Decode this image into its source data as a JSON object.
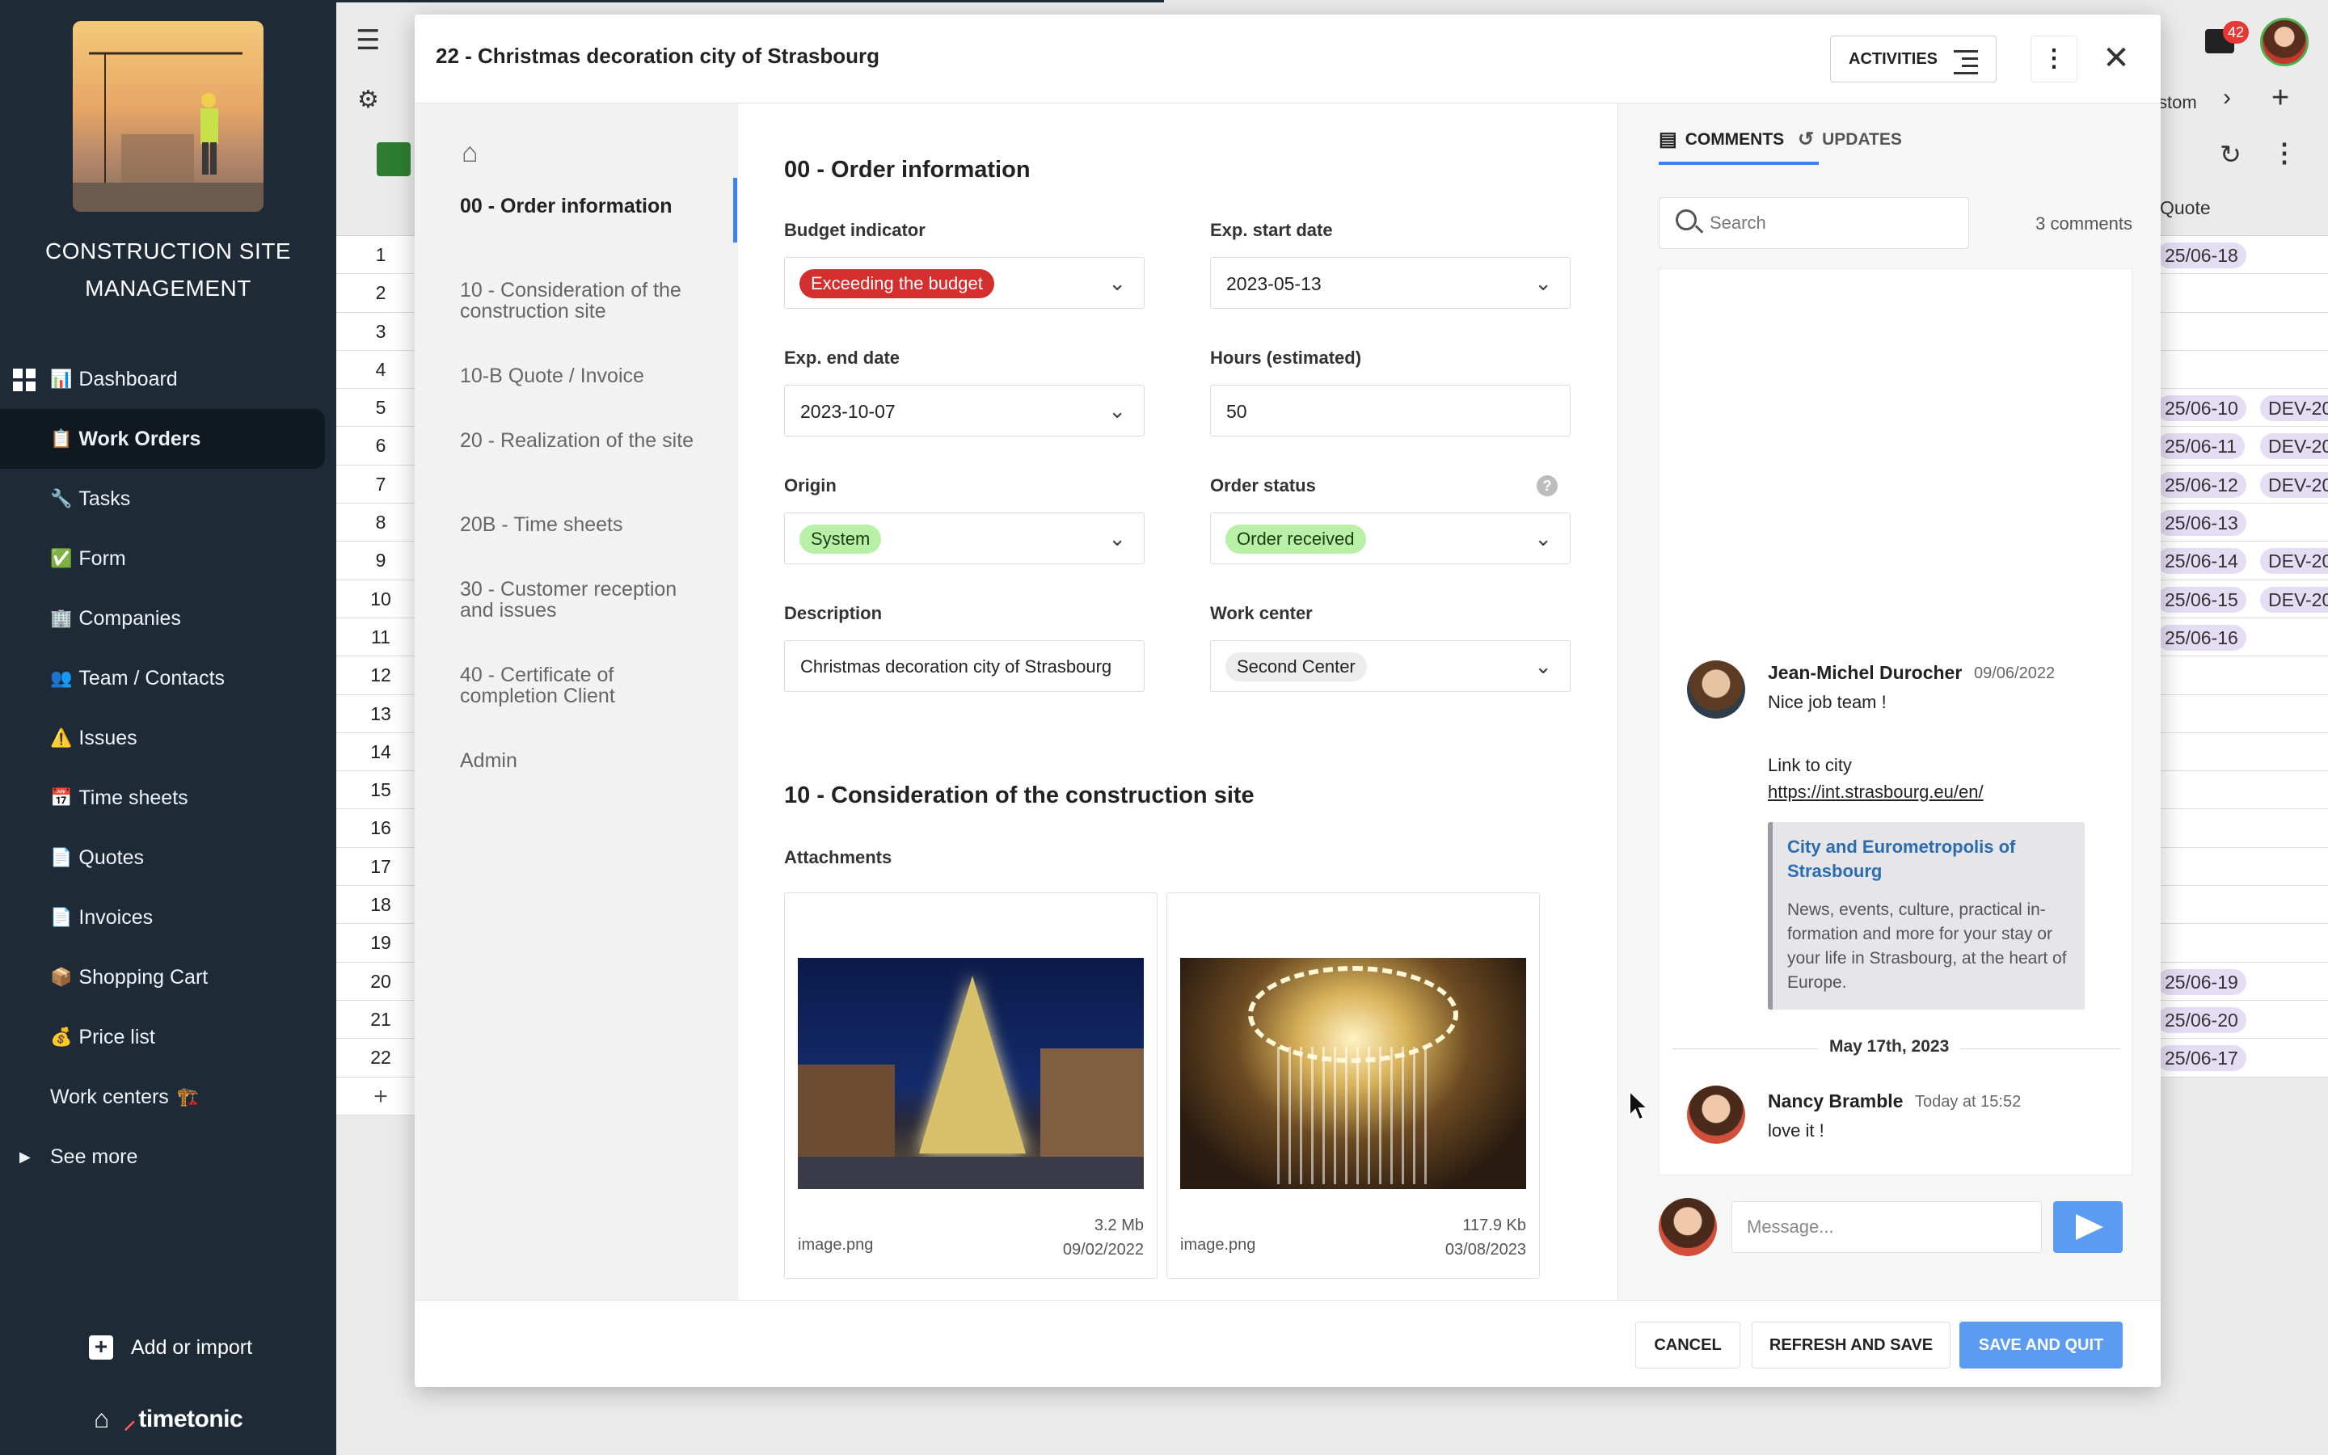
{
  "app": {
    "title": "CONSTRUCTION SITE MANAGEMENT",
    "brand_name": "timetonic",
    "add_import_label": "Add or import",
    "notification_count": "42"
  },
  "sidebar": {
    "items": [
      {
        "emoji": "📊",
        "label": "Dashboard"
      },
      {
        "emoji": "📋",
        "label": "Work Orders",
        "active": true
      },
      {
        "emoji": "🔧",
        "label": "Tasks"
      },
      {
        "emoji": "✅",
        "label": "Form"
      },
      {
        "emoji": "🏢",
        "label": "Companies"
      },
      {
        "emoji": "👥",
        "label": "Team / Contacts"
      },
      {
        "emoji": "⚠️",
        "label": "Issues"
      },
      {
        "emoji": "📅",
        "label": "Time sheets"
      },
      {
        "emoji": "📄",
        "label": "Quotes"
      },
      {
        "emoji": "📄",
        "label": "Invoices"
      },
      {
        "emoji": "📦",
        "label": "Shopping Cart"
      },
      {
        "emoji": "💰",
        "label": "Price list"
      },
      {
        "emoji": "🏗️",
        "label": "Work centers",
        "emoji_after": true
      },
      {
        "emoji": "",
        "label": "See more",
        "expandable": true
      }
    ]
  },
  "background_table": {
    "row_numbers": [
      "1",
      "2",
      "3",
      "4",
      "5",
      "6",
      "7",
      "8",
      "9",
      "10",
      "11",
      "12",
      "13",
      "14",
      "15",
      "16",
      "17",
      "18",
      "19",
      "20",
      "21",
      "22"
    ],
    "quote_header": "Quote",
    "breadcrumb_tail": "stom",
    "right_cells": [
      {
        "date": "25/06-18",
        "dev": ""
      },
      {
        "date": "",
        "dev": ""
      },
      {
        "date": "",
        "dev": ""
      },
      {
        "date": "",
        "dev": ""
      },
      {
        "date": "25/06-10",
        "dev": "DEV-20"
      },
      {
        "date": "25/06-11",
        "dev": "DEV-20"
      },
      {
        "date": "25/06-12",
        "dev": "DEV-20"
      },
      {
        "date": "25/06-13",
        "dev": ""
      },
      {
        "date": "25/06-14",
        "dev": "DEV-20"
      },
      {
        "date": "25/06-15",
        "dev": "DEV-20"
      },
      {
        "date": "25/06-16",
        "dev": ""
      },
      {
        "date": "",
        "dev": ""
      },
      {
        "date": "",
        "dev": ""
      },
      {
        "date": "",
        "dev": ""
      },
      {
        "date": "",
        "dev": ""
      },
      {
        "date": "",
        "dev": ""
      },
      {
        "date": "",
        "dev": ""
      },
      {
        "date": "",
        "dev": ""
      },
      {
        "date": "",
        "dev": ""
      },
      {
        "date": "25/06-19",
        "dev": ""
      },
      {
        "date": "25/06-20",
        "dev": ""
      },
      {
        "date": "25/06-17",
        "dev": ""
      }
    ]
  },
  "modal": {
    "title": "22 - Christmas decoration city of Strasbourg",
    "activities_label": "ACTIVITIES",
    "sections": [
      {
        "label": "00 - Order information",
        "active": true
      },
      {
        "label": "10 - Consideration of the construction site"
      },
      {
        "label": "10-B Quote / Invoice"
      },
      {
        "label": "20 - Realization of the site"
      },
      {
        "label": "20B - Time sheets"
      },
      {
        "label": "30 - Customer reception and issues"
      },
      {
        "label": "40 - Certificate of completion Client"
      },
      {
        "label": "Admin"
      }
    ],
    "form": {
      "section_title": "00 - Order information",
      "budget_indicator": {
        "label": "Budget indicator",
        "value": "Exceeding the budget",
        "color": "#d32f2f"
      },
      "exp_start_date": {
        "label": "Exp. start date",
        "value": "2023-05-13"
      },
      "exp_end_date": {
        "label": "Exp. end date",
        "value": "2023-10-07"
      },
      "hours_estimated": {
        "label": "Hours (estimated)",
        "value": "50"
      },
      "origin": {
        "label": "Origin",
        "value": "System",
        "color": "#b9f0a8"
      },
      "order_status": {
        "label": "Order status",
        "value": "Order received",
        "color": "#b9f0a8"
      },
      "description": {
        "label": "Description",
        "value": "Christmas decoration city of Strasbourg"
      },
      "work_center": {
        "label": "Work center",
        "value": "Second Center"
      },
      "section2_title": "10 - Consideration of the construction site",
      "attachments_label": "Attachments",
      "attachments": [
        {
          "name": "image.png",
          "size": "3.2 Mb",
          "date": "09/02/2022"
        },
        {
          "name": "image.png",
          "size": "117.9 Kb",
          "date": "03/08/2023"
        }
      ]
    },
    "comments_panel": {
      "tab_comments": "COMMENTS",
      "tab_updates": "UPDATES",
      "search_placeholder": "Search",
      "count": "3 comments",
      "comments": [
        {
          "author": "Jean-Michel Durocher",
          "time": "09/06/2022",
          "text": "Nice job team !"
        },
        {
          "author": "",
          "time": "",
          "text": "Link to city",
          "link": "https://int.strasbourg.eu/en/",
          "preview_title": "City and Eurometropolis of Strasbourg",
          "preview_desc": "News, events, culture, practical in-formation and more for your stay or your life in Strasbourg, at the heart of Europe."
        },
        {
          "author": "Nancy Bramble",
          "time": "Today at 15:52",
          "text": "love it !"
        }
      ],
      "date_separator": "May 17th, 2023",
      "message_placeholder": "Message..."
    },
    "footer": {
      "cancel": "CANCEL",
      "refresh_save": "REFRESH AND SAVE",
      "save_quit": "SAVE AND QUIT"
    }
  }
}
